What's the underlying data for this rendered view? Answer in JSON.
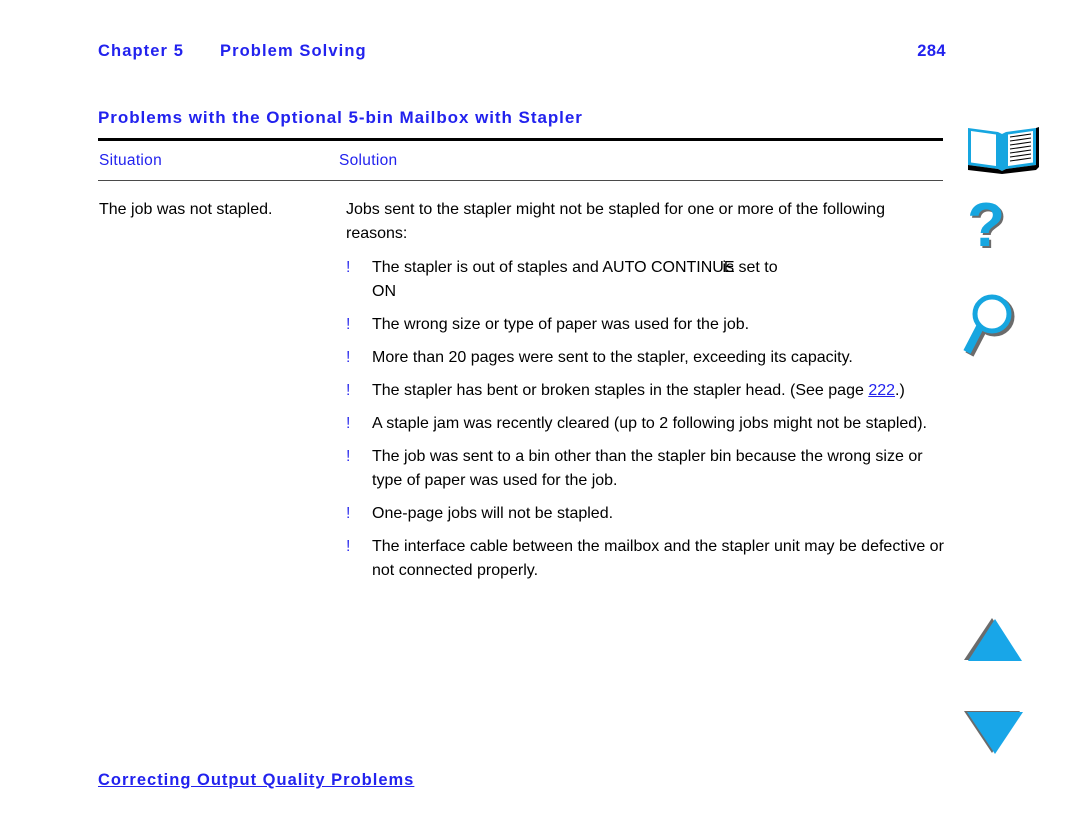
{
  "header": {
    "chapter_label": "Chapter 5",
    "chapter_title": "Problem Solving",
    "page_number": "284"
  },
  "section": {
    "heading": "Problems with the Optional 5-bin Mailbox with Stapler"
  },
  "table": {
    "columns": {
      "situation": "Situation",
      "solution": "Solution"
    },
    "row": {
      "situation": "The job was not stapled.",
      "solution_intro": "Jobs sent to the stapler might not be stapled for one or more of the following reasons:",
      "bullet_marker": "!",
      "bullets": [
        {
          "text_before": "The stapler is out of staples and AUTO CONTINUE",
          "text_overlap": "is set to",
          "text_after": "ON"
        },
        {
          "text": "The wrong size or type of paper was used for the job."
        },
        {
          "text": "More than 20 pages were sent to the stapler, exceeding its capacity."
        },
        {
          "text_before": "The stapler has bent or broken staples in the stapler head. (See page ",
          "link": "222",
          "text_after": ".)"
        },
        {
          "text": "A staple jam was recently cleared (up to 2 following jobs might not be stapled)."
        },
        {
          "text": "The job was sent to a bin other than the stapler bin because the wrong size or type of paper was used for the job."
        },
        {
          "text": "One-page jobs will not be stapled."
        },
        {
          "text": "The interface cable between the mailbox and the stapler unit may be defective or not connected properly."
        }
      ]
    }
  },
  "footer": {
    "link": "Correcting Output Quality Problems"
  },
  "icons": {
    "book": "book-icon",
    "help": "question-mark-icon",
    "find": "magnifier-icon",
    "up": "up-triangle-icon",
    "down": "down-triangle-icon"
  },
  "colors": {
    "link_blue": "#2222ee",
    "icon_cyan": "#16a6e0",
    "arrow_blue": "#18a6e8",
    "shadow_gray": "#6b6b6b",
    "text_black": "#000000"
  }
}
